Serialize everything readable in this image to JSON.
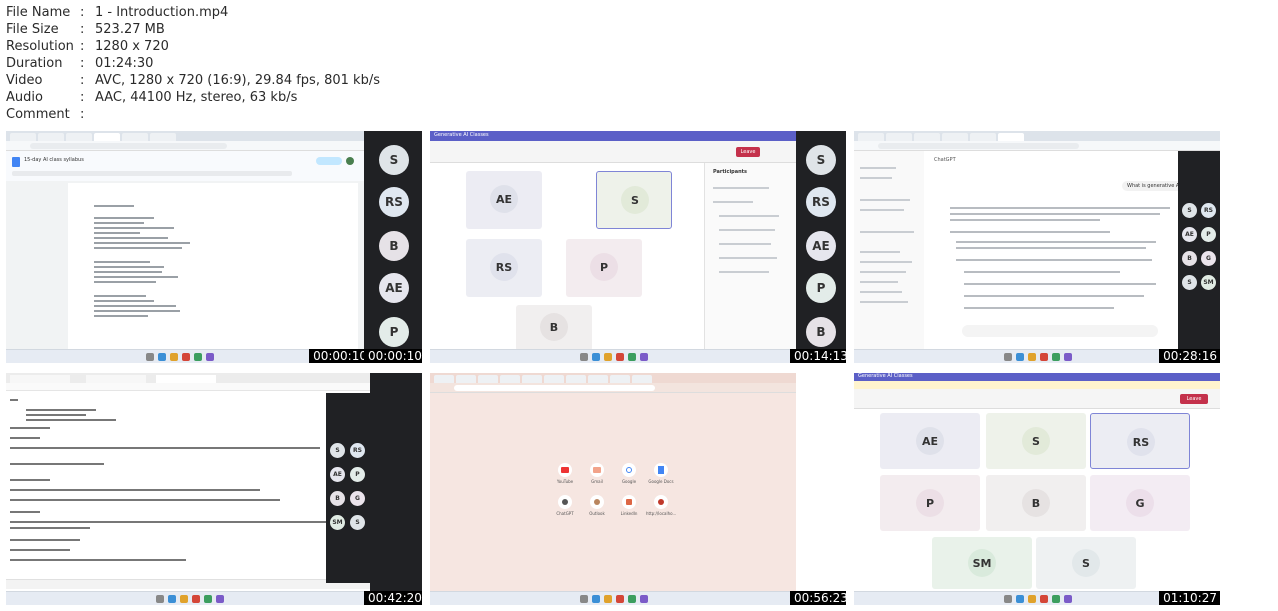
{
  "metadata": [
    {
      "key": "File Name",
      "value": "1 - Introduction.mp4"
    },
    {
      "key": "File Size",
      "value": "523.27 MB"
    },
    {
      "key": "Resolution",
      "value": "1280 x 720"
    },
    {
      "key": "Duration",
      "value": "01:24:30"
    },
    {
      "key": "Video",
      "value": "AVC, 1280 x 720 (16:9), 29.84 fps, 801 kb/s"
    },
    {
      "key": "Audio",
      "value": "AAC, 44100 Hz, stereo, 63 kb/s"
    },
    {
      "key": "Comment",
      "value": ""
    }
  ],
  "separator": ":",
  "thumbnails": [
    {
      "timestamp": "00:00:10",
      "doc_title": "15-day AI class syllabus",
      "side_avatars": [
        "S",
        "RS",
        "B",
        "AE",
        "P"
      ]
    },
    {
      "timestamp": "00:14:13",
      "meeting_title": "Generative AI Classes",
      "leave_label": "Leave",
      "participants_title": "Participants",
      "tiles": [
        "AE",
        "S",
        "RS",
        "P",
        "B"
      ],
      "side_avatars": [
        "S",
        "RS",
        "AE",
        "P",
        "B"
      ]
    },
    {
      "timestamp": "00:28:16",
      "app_title": "ChatGPT",
      "question": "What is generative AI?",
      "side_avatars": [
        "S",
        "RS",
        "AE",
        "P",
        "B",
        "G",
        "S",
        "SM"
      ]
    },
    {
      "timestamp": "00:42:20",
      "side_avatars": [
        "S",
        "RS",
        "AE",
        "P",
        "B",
        "G",
        "SM",
        "S"
      ]
    },
    {
      "timestamp": "00:56:23",
      "shortcuts": [
        "YouTube",
        "Gmail",
        "Google",
        "Google Docs",
        "ChatGPT",
        "Outlook",
        "LinkedIn",
        "http://localho..."
      ]
    },
    {
      "timestamp": "01:10:27",
      "meeting_title": "Generative AI Classes",
      "leave_label": "Leave",
      "tiles": [
        "AE",
        "S",
        "RS",
        "P",
        "B",
        "G",
        "SM",
        "S"
      ]
    }
  ]
}
